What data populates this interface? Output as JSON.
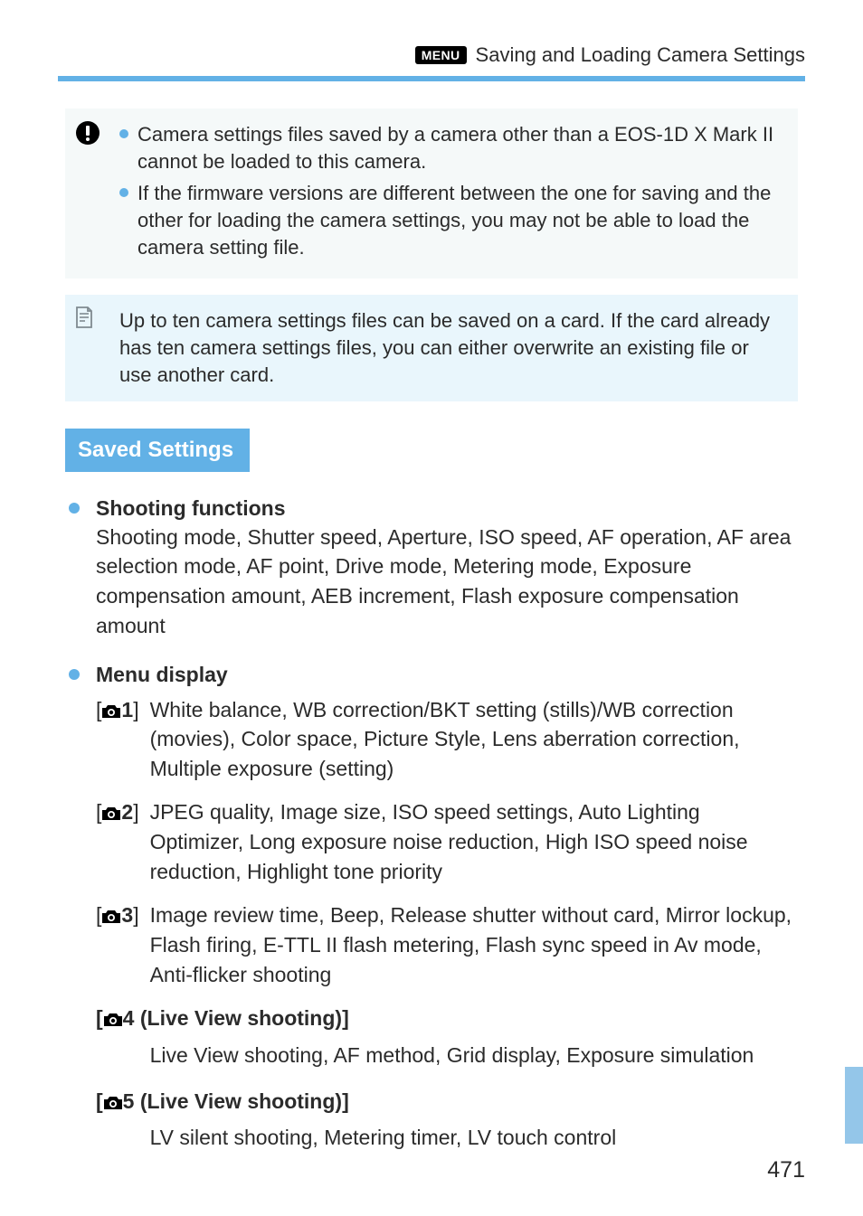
{
  "header": {
    "menu_badge": "MENU",
    "title": "Saving and Loading Camera Settings"
  },
  "warn_box": {
    "bullets": [
      "Camera settings files saved by a camera other than a EOS-1D X Mark II cannot be loaded to this camera.",
      "If the firmware versions are different between the one for saving and the other for loading the camera settings, you may not be able to load the camera setting file."
    ]
  },
  "hint_box": {
    "text": "Up to ten camera settings files can be saved on a card. If the card already has ten camera settings files, you can either overwrite an existing file or use another card."
  },
  "section_title": "Saved Settings",
  "shooting": {
    "title": "Shooting functions",
    "body": "Shooting mode, Shutter speed, Aperture, ISO speed, AF operation, AF area selection mode, AF point, Drive mode, Metering mode, Exposure compensation amount, AEB increment, Flash exposure compensation amount"
  },
  "menu_display": {
    "title": "Menu display",
    "rows": [
      {
        "num": "1",
        "extra": "",
        "bold_label": false,
        "inline_desc": true,
        "desc": "White balance, WB correction/BKT setting (stills)/WB correction (movies), Color space, Picture Style, Lens aberration correction, Multiple exposure (setting)"
      },
      {
        "num": "2",
        "extra": "",
        "bold_label": false,
        "inline_desc": true,
        "desc": "JPEG quality, Image size, ISO speed settings, Auto Lighting Optimizer, Long exposure noise reduction, High ISO speed noise reduction, Highlight tone priority"
      },
      {
        "num": "3",
        "extra": "",
        "bold_label": false,
        "inline_desc": true,
        "desc": "Image review time, Beep, Release shutter without card, Mirror lockup, Flash firing, E-TTL II flash metering, Flash sync speed in Av mode, Anti-flicker shooting"
      },
      {
        "num": "4",
        "extra": " (Live View shooting)",
        "bold_label": true,
        "inline_desc": false,
        "desc": "Live View shooting, AF method, Grid display, Exposure simulation"
      },
      {
        "num": "5",
        "extra": " (Live View shooting)",
        "bold_label": true,
        "inline_desc": false,
        "desc": "LV silent shooting, Metering timer, LV touch control"
      }
    ]
  },
  "page_number": "471"
}
